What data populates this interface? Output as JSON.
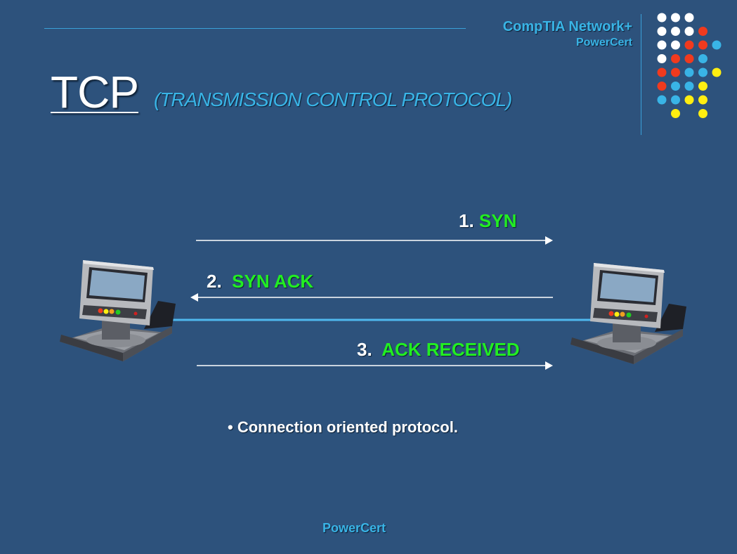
{
  "header": {
    "brand_line1": "CompTIA Network+",
    "brand_line2": "PowerCert"
  },
  "title": {
    "main": "TCP",
    "subtitle": "(TRANSMISSION CONTROL PROTOCOL)"
  },
  "handshake": {
    "steps": [
      {
        "number": "1.",
        "message": "SYN",
        "direction": "right"
      },
      {
        "number": "2.",
        "message": "SYN ACK",
        "direction": "left"
      },
      {
        "number": "3.",
        "message": "ACK RECEIVED",
        "direction": "right"
      }
    ]
  },
  "bullet": "• Connection oriented protocol.",
  "footer": "PowerCert",
  "colors": {
    "background": "#2d527c",
    "accent": "#39b4e6",
    "message_green": "#22ee22",
    "link_line": "#4fb8ee",
    "dot_white": "#ffffff",
    "dot_red": "#f03a1e",
    "dot_blue": "#39b4e6",
    "dot_yellow": "#ffee11"
  },
  "decor": {
    "dot_grid": [
      [
        "white",
        "white",
        "white",
        null,
        null
      ],
      [
        "white",
        "white",
        "white",
        "red",
        null
      ],
      [
        "white",
        "white",
        "red",
        "red",
        "blue"
      ],
      [
        "white",
        "red",
        "red",
        "blue",
        null
      ],
      [
        "red",
        "red",
        "blue",
        "blue",
        "yellow"
      ],
      [
        "red",
        "blue",
        "blue",
        "yellow",
        null
      ],
      [
        "blue",
        "blue",
        "yellow",
        "yellow",
        null
      ],
      [
        null,
        "yellow",
        null,
        "yellow",
        null
      ]
    ]
  }
}
